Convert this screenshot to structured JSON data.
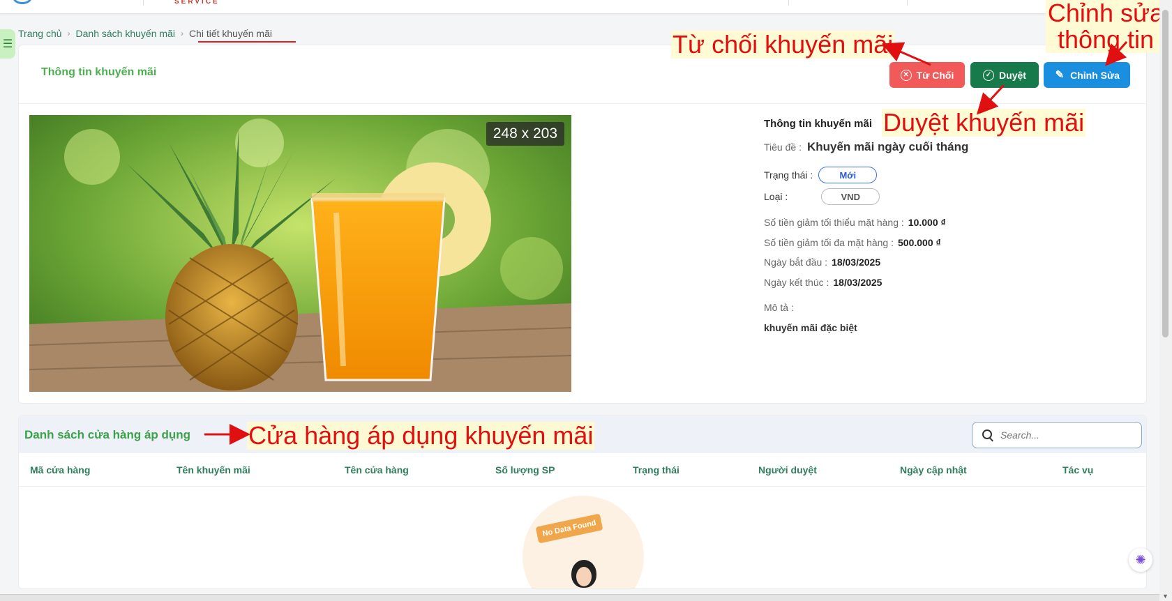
{
  "header": {
    "logo_text": "SERVICE"
  },
  "breadcrumb": {
    "home": "Trang chủ",
    "list": "Danh sách khuyến mãi",
    "current": "Chi tiết khuyến mãi"
  },
  "card": {
    "title": "Thông tin khuyến mãi"
  },
  "actions": {
    "reject": "Từ Chối",
    "approve": "Duyệt",
    "edit": "Chỉnh Sửa"
  },
  "image": {
    "dimensions_label": "248 x 203"
  },
  "details": {
    "section_title": "Thông tin khuyến mãi",
    "title_label": "Tiêu đề :",
    "title_value": "Khuyến mãi ngày cuối tháng",
    "status_label": "Trạng thái :",
    "status_value": "Mới",
    "type_label": "Loại :",
    "type_value": "VND",
    "min_label": "Số tiền giảm tối thiểu mặt hàng :",
    "min_value": "10.000 ₫",
    "max_label": "Số tiền giảm tối đa mặt hàng :",
    "max_value": "500.000 ₫",
    "start_label": "Ngày bắt đầu :",
    "start_value": "18/03/2025",
    "end_label": "Ngày kết thúc :",
    "end_value": "18/03/2025",
    "desc_label": "Mô tả :",
    "desc_value": "khuyến mãi đặc biệt"
  },
  "annotations": {
    "reject": "Từ chối khuyến mãi",
    "approve": "Duyệt khuyến mãi",
    "edit": "Chỉnh sửa thông tin",
    "stores": "Cửa hàng áp dụng khuyến mãi"
  },
  "stores": {
    "title": "Danh sách cửa hàng áp dụng",
    "search_placeholder": "Search...",
    "columns": [
      "Mã cửa hàng",
      "Tên khuyến mãi",
      "Tên cửa hàng",
      "Số lượng SP",
      "Trạng thái",
      "Người duyệt",
      "Ngày cập nhật",
      "Tác vụ"
    ],
    "empty_text": "No Data Found"
  },
  "colors": {
    "reject": "#f25a5a",
    "approve": "#177a4a",
    "edit": "#1a8fe0",
    "accent_green": "#4caf50",
    "annotation": "#e01010"
  }
}
